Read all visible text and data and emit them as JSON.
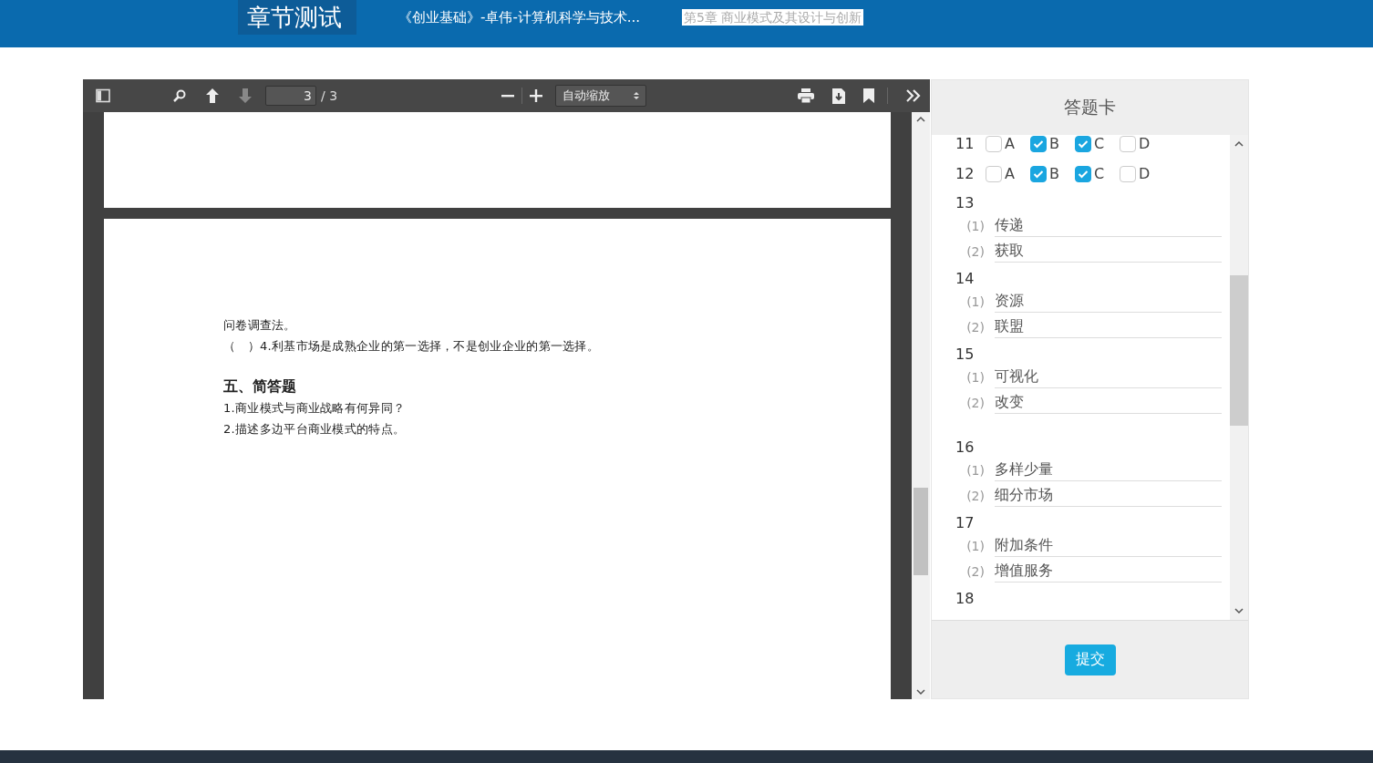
{
  "header": {
    "title": "章节测试",
    "course": "《创业基础》-卓伟-计算机科学与技术...",
    "chapter": "第5章 商业模式及其设计与创新"
  },
  "viewer": {
    "toolbar": {
      "page_number": "3",
      "page_count": "/ 3",
      "zoom": "自动缩放"
    },
    "document": {
      "lines": [
        {
          "kind": "text",
          "text": "问卷调查法。"
        },
        {
          "kind": "text",
          "text": "（　）4.利基市场是成熟企业的第一选择，不是创业企业的第一选择。"
        },
        {
          "kind": "heading",
          "text": "五、简答题"
        },
        {
          "kind": "text",
          "text": "1.商业模式与商业战略有何异同？"
        },
        {
          "kind": "text",
          "text": "2.描述多边平台商业模式的特点。"
        }
      ]
    }
  },
  "answer_card": {
    "title": "答题卡",
    "questions": [
      {
        "kind": "choice",
        "number": "11",
        "options": [
          {
            "label": "A",
            "checked": false
          },
          {
            "label": "B",
            "checked": true
          },
          {
            "label": "C",
            "checked": true
          },
          {
            "label": "D",
            "checked": false
          }
        ]
      },
      {
        "kind": "choice",
        "number": "12",
        "options": [
          {
            "label": "A",
            "checked": false
          },
          {
            "label": "B",
            "checked": true
          },
          {
            "label": "C",
            "checked": true
          },
          {
            "label": "D",
            "checked": false
          }
        ]
      },
      {
        "kind": "fill",
        "number": "13",
        "blanks": [
          {
            "index": "(1)",
            "answer": "传递"
          },
          {
            "index": "(2)",
            "answer": "获取"
          }
        ]
      },
      {
        "kind": "fill",
        "number": "14",
        "blanks": [
          {
            "index": "(1)",
            "answer": "资源"
          },
          {
            "index": "(2)",
            "answer": "联盟"
          }
        ]
      },
      {
        "kind": "fill",
        "number": "15",
        "blanks": [
          {
            "index": "(1)",
            "answer": "可视化"
          },
          {
            "index": "(2)",
            "answer": "改变"
          }
        ]
      },
      {
        "kind": "fill",
        "number": "16",
        "blanks": [
          {
            "index": "(1)",
            "answer": "多样少量"
          },
          {
            "index": "(2)",
            "answer": "细分市场"
          }
        ]
      },
      {
        "kind": "fill",
        "number": "17",
        "blanks": [
          {
            "index": "(1)",
            "answer": "附加条件"
          },
          {
            "index": "(2)",
            "answer": "增值服务"
          }
        ]
      },
      {
        "kind": "fill",
        "number": "18"
      }
    ],
    "submit": "提交"
  }
}
